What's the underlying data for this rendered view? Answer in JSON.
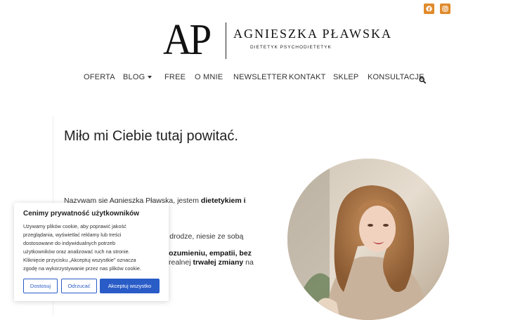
{
  "social": {
    "icons": [
      "facebook-icon",
      "instagram-icon"
    ],
    "color": "#e08a2c"
  },
  "logo": {
    "monogram": "AP",
    "name": "AGNIESZKA PŁAWSKA",
    "subtitle": "DIETETYK PSYCHODIETETYK"
  },
  "nav": {
    "items": [
      "OFERTA",
      "BLOG",
      "FREE",
      "O MNIE",
      "NEWSLETTER",
      "KONTAKT",
      "SKLEP",
      "KONSULTACJE"
    ],
    "search_icon": "search-icon"
  },
  "main": {
    "heading": "Miło mi Ciebie tutaj powitać.",
    "lines": [
      {
        "pre": "Nazywam sie Agnieszka Pławska, jestem ",
        "bold": "dietetykiem i",
        "post": ""
      },
      {
        "pre": "",
        "bold": "",
        "post": "j drodze, niesie ze sobą"
      },
      {
        "pre": "",
        "bold": "rozumieniu, empatii, bez",
        "post": ""
      },
      {
        "pre": "realnej ",
        "bold": "trwałej zmiany",
        "post": " na"
      }
    ]
  },
  "cookie": {
    "title": "Cenimy prywatność użytkowników",
    "body": [
      "Używamy plików cookie, aby poprawić jakość",
      "przeglądania, wyświetlać reklamy lub treści",
      "dostosowane do indywidualnych potrzeb",
      "użytkowników oraz analizować ruch na stronie.",
      "Kliknięcie przycisku „Akceptuj wszystkie” oznacza",
      "zgodę na wykorzystywanie przez nas plików cookie."
    ],
    "buttons": {
      "customize": "Dostosuj",
      "reject": "Odrzucać",
      "accept": "Akceptuj wszystko"
    },
    "accent": "#2a5cc7"
  }
}
